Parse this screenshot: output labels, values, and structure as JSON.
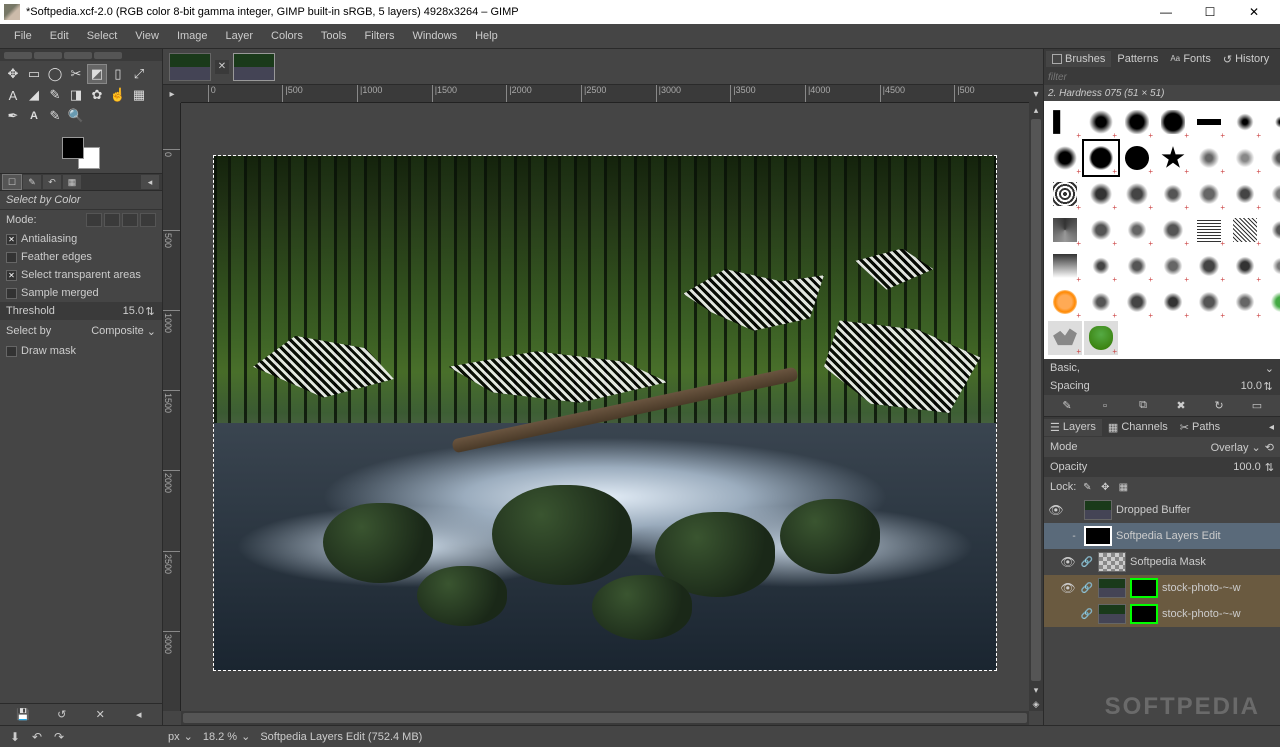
{
  "window": {
    "title": "*Softpedia.xcf-2.0 (RGB color 8-bit gamma integer, GIMP built-in sRGB, 5 layers) 4928x3264 – GIMP",
    "min": "—",
    "max": "☐",
    "close": "✕"
  },
  "menu": [
    "File",
    "Edit",
    "Select",
    "View",
    "Image",
    "Layer",
    "Colors",
    "Tools",
    "Filters",
    "Windows",
    "Help"
  ],
  "tool_options": {
    "title": "Select by Color",
    "mode_label": "Mode:",
    "antialiasing": "Antialiasing",
    "feather": "Feather edges",
    "transparent": "Select transparent areas",
    "sample_merged": "Sample merged",
    "threshold_label": "Threshold",
    "threshold_value": "15.0",
    "selectby_label": "Select by",
    "selectby_value": "Composite",
    "draw_mask": "Draw mask"
  },
  "ruler_h": [
    "0",
    "|500",
    "|1000",
    "|1500",
    "|2000",
    "|2500",
    "|3000",
    "|3500",
    "|4000",
    "|4500",
    "|500"
  ],
  "ruler_v": [
    "0",
    "500",
    "1000",
    "1500",
    "2000",
    "2500",
    "3000"
  ],
  "right": {
    "tabs1": [
      "Brushes",
      "Patterns",
      "Fonts",
      "History"
    ],
    "filter_placeholder": "filter",
    "brush_name": "2. Hardness 075 (51 × 51)",
    "preset": "Basic,",
    "spacing_label": "Spacing",
    "spacing_value": "10.0",
    "tabs2": [
      "Layers",
      "Channels",
      "Paths"
    ],
    "mode_label": "Mode",
    "mode_value": "Overlay",
    "opacity_label": "Opacity",
    "opacity_value": "100.0",
    "lock_label": "Lock:"
  },
  "layers": [
    {
      "name": "Dropped Buffer",
      "vis": true,
      "thumb": "img"
    },
    {
      "name": "Softpedia Layers Edit",
      "vis": false,
      "sel": true,
      "mask": true,
      "exp": "-"
    },
    {
      "name": "Softpedia Mask",
      "vis": true,
      "thumb": "chk",
      "indent": 1
    },
    {
      "name": "stock-photo-~-w",
      "vis": true,
      "thumb": "img",
      "mask_grn": true,
      "indent": 1,
      "grp": true
    },
    {
      "name": "stock-photo-~-w",
      "vis": false,
      "thumb": "img",
      "mask_grn": true,
      "indent": 1,
      "grp": true
    }
  ],
  "status": {
    "unit": "px",
    "zoom": "18.2 %",
    "info": "Softpedia Layers Edit (752.4 MB)"
  },
  "watermark": "SOFTPEDIA"
}
